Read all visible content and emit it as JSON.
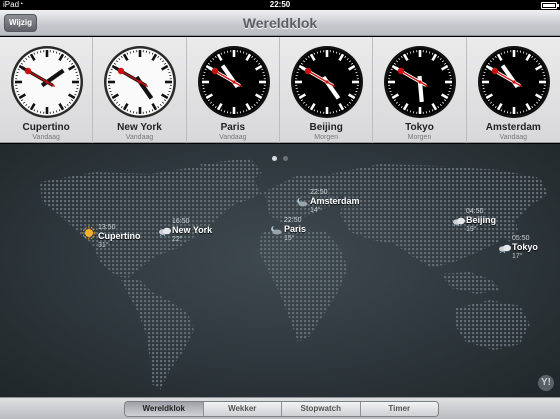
{
  "status": {
    "carrier": "iPad",
    "time": "22:50"
  },
  "nav": {
    "title": "Wereldklok",
    "edit_label": "Wijzig"
  },
  "clocks": [
    {
      "city": "Cupertino",
      "day": "Vandaag",
      "face": "light",
      "hour": 13,
      "minute": 50
    },
    {
      "city": "New York",
      "day": "Vandaag",
      "face": "light",
      "hour": 16,
      "minute": 50
    },
    {
      "city": "Paris",
      "day": "Vandaag",
      "face": "dark",
      "hour": 22,
      "minute": 50
    },
    {
      "city": "Beijing",
      "day": "Morgen",
      "face": "dark",
      "hour": 4,
      "minute": 50
    },
    {
      "city": "Tokyo",
      "day": "Morgen",
      "face": "dark",
      "hour": 5,
      "minute": 50
    },
    {
      "city": "Amsterdam",
      "day": "Vandaag",
      "face": "dark",
      "hour": 22,
      "minute": 50
    }
  ],
  "markers": [
    {
      "city": "Cupertino",
      "time": "13:50",
      "temp": "31°",
      "icon": "sun-icon"
    },
    {
      "city": "New York",
      "time": "16:50",
      "temp": "22°",
      "icon": "cloud-icon"
    },
    {
      "city": "Amsterdam",
      "time": "22:50",
      "temp": "14°",
      "icon": "moon-cloud-icon"
    },
    {
      "city": "Paris",
      "time": "22:50",
      "temp": "15°",
      "icon": "moon-cloud-icon"
    },
    {
      "city": "Beijing",
      "time": "04:50",
      "temp": "19°",
      "icon": "cloud-icon"
    },
    {
      "city": "Tokyo",
      "time": "05:50",
      "temp": "17°",
      "icon": "cloud-icon"
    }
  ],
  "yahoo_label": "Y!",
  "tabs": [
    "Wereldklok",
    "Wekker",
    "Stopwatch",
    "Timer"
  ],
  "active_tab": 0,
  "colors": {
    "accent_red": "#cc1111",
    "map_bg": "#2c353a"
  }
}
